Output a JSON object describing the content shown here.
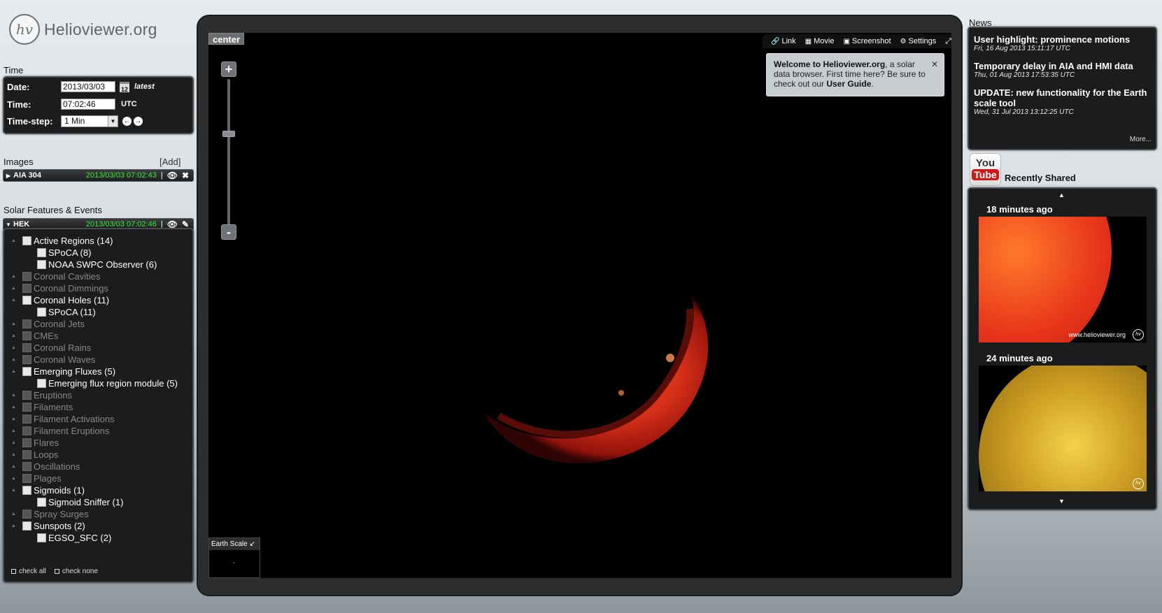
{
  "app": {
    "title": "Helioviewer.org",
    "logo_mark": "hv"
  },
  "time": {
    "section_title": "Time",
    "date_label": "Date:",
    "date_value": "2013/03/03",
    "calendar_icon_text": "12",
    "latest_label": "latest",
    "time_label": "Time:",
    "time_value": "07:02:46",
    "utc_label": "UTC",
    "timestep_label": "Time-step:",
    "timestep_value": "1 Min"
  },
  "images": {
    "section_title": "Images",
    "add_label": "[Add]",
    "layers": [
      {
        "name": "AIA 304",
        "timestamp": "2013/03/03 07:02:43"
      }
    ]
  },
  "events": {
    "section_title": "Solar Features & Events",
    "source": "HEK",
    "timestamp": "2013/03/03 07:02:46",
    "check_all": "check all",
    "check_none": "check none",
    "items": [
      {
        "label": "Active Regions (14)",
        "level": 0,
        "active": true
      },
      {
        "label": "SPoCA (8)",
        "level": 1,
        "active": true
      },
      {
        "label": "NOAA SWPC Observer (6)",
        "level": 1,
        "active": true
      },
      {
        "label": "Coronal Cavities",
        "level": 0,
        "active": false
      },
      {
        "label": "Coronal Dimmings",
        "level": 0,
        "active": false
      },
      {
        "label": "Coronal Holes (11)",
        "level": 0,
        "active": true
      },
      {
        "label": "SPoCA (11)",
        "level": 1,
        "active": true
      },
      {
        "label": "Coronal Jets",
        "level": 0,
        "active": false
      },
      {
        "label": "CMEs",
        "level": 0,
        "active": false
      },
      {
        "label": "Coronal Rains",
        "level": 0,
        "active": false
      },
      {
        "label": "Coronal Waves",
        "level": 0,
        "active": false
      },
      {
        "label": "Emerging Fluxes (5)",
        "level": 0,
        "active": true
      },
      {
        "label": "Emerging flux region module (5)",
        "level": 1,
        "active": true
      },
      {
        "label": "Eruptions",
        "level": 0,
        "active": false
      },
      {
        "label": "Filaments",
        "level": 0,
        "active": false
      },
      {
        "label": "Filament Activations",
        "level": 0,
        "active": false
      },
      {
        "label": "Filament Eruptions",
        "level": 0,
        "active": false
      },
      {
        "label": "Flares",
        "level": 0,
        "active": false
      },
      {
        "label": "Loops",
        "level": 0,
        "active": false
      },
      {
        "label": "Oscillations",
        "level": 0,
        "active": false
      },
      {
        "label": "Plages",
        "level": 0,
        "active": false
      },
      {
        "label": "Sigmoids (1)",
        "level": 0,
        "active": true
      },
      {
        "label": "Sigmoid Sniffer (1)",
        "level": 1,
        "active": true
      },
      {
        "label": "Spray Surges",
        "level": 0,
        "active": false
      },
      {
        "label": "Sunspots (2)",
        "level": 0,
        "active": true
      },
      {
        "label": "EGSO_SFC (2)",
        "level": 1,
        "active": true
      }
    ]
  },
  "viewport": {
    "center_label": "center",
    "toolbar": {
      "link": "Link",
      "movie": "Movie",
      "screenshot": "Screenshot",
      "settings": "Settings"
    },
    "zoom_in": "+",
    "zoom_out": "-",
    "earth_scale_label": "Earth Scale",
    "welcome": {
      "bold_intro": "Welcome to Helioviewer.org",
      "text": ", a solar data browser. First time here? Be sure to check out our ",
      "link": "User Guide",
      "end": "."
    }
  },
  "news": {
    "title": "News",
    "items": [
      {
        "title": "User highlight: prominence motions",
        "date": "Fri, 16 Aug 2013 15:11:17 UTC"
      },
      {
        "title": "Temporary delay in AIA and HMI data",
        "date": "Thu, 01 Aug 2013 17:53:35 UTC"
      },
      {
        "title": "UPDATE: new functionality for the Earth scale tool",
        "date": "Wed, 31 Jul 2013 13:12:25 UTC"
      }
    ],
    "more": "More..."
  },
  "shared": {
    "youtube_you": "You",
    "youtube_tube": "Tube",
    "title": "Recently Shared",
    "items": [
      {
        "time": "18 minutes ago",
        "watermark": "www.helioviewer.org"
      },
      {
        "time": "24 minutes ago"
      }
    ]
  },
  "colors": {
    "timestamp_green": "#39e839",
    "panel_bg": "#1b1c1d",
    "sun_red": "#e8351a",
    "youtube_red": "#cc1a1a"
  }
}
